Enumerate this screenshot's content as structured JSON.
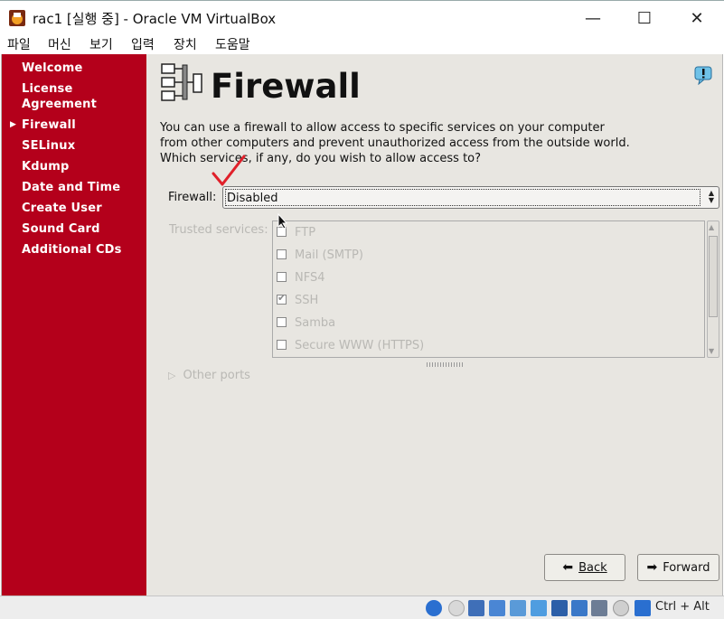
{
  "window": {
    "title": "rac1 [실행 중] - Oracle VM VirtualBox",
    "minimize": "—",
    "maximize": "☐",
    "close": "✕"
  },
  "menu": [
    "파일",
    "머신",
    "보기",
    "입력",
    "장치",
    "도움말"
  ],
  "sidebar": {
    "items": [
      "Welcome",
      "License Agreement",
      "Firewall",
      "SELinux",
      "Kdump",
      "Date and Time",
      "Create User",
      "Sound Card",
      "Additional CDs"
    ],
    "current": "Firewall"
  },
  "page": {
    "title": "Firewall",
    "intro": "You can use a firewall to allow access to specific services on your computer from other computers and prevent unauthorized access from the outside world.  Which services, if any, do you wish to allow access to?",
    "firewall_label": "Firewall:",
    "firewall_value": "Disabled",
    "trusted_label": "Trusted services:",
    "services": [
      {
        "name": "FTP",
        "checked": false
      },
      {
        "name": "Mail (SMTP)",
        "checked": false
      },
      {
        "name": "NFS4",
        "checked": false
      },
      {
        "name": "SSH",
        "checked": true
      },
      {
        "name": "Samba",
        "checked": false
      },
      {
        "name": "Secure WWW (HTTPS)",
        "checked": false
      }
    ],
    "other_ports": "Other ports",
    "back_label": "Back",
    "forward_label": "Forward"
  },
  "statusbar": {
    "host_key": "Ctrl + Alt"
  },
  "colors": {
    "sidebar": "#b4001b",
    "guest_bg": "#e8e6e1",
    "disabled_text": "#b9b8b4",
    "annotation_check": "#e0202a"
  }
}
